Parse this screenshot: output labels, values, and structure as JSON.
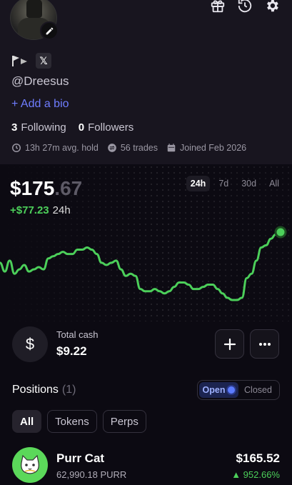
{
  "profile": {
    "handle": "@Dreesus",
    "add_bio": "+ Add a bio",
    "following_count": "3",
    "following_label": "Following",
    "followers_count": "0",
    "followers_label": "Followers",
    "avg_hold": "13h 27m avg. hold",
    "trades": "56 trades",
    "joined": "Joined Feb 2026",
    "social_x": "𝕏"
  },
  "portfolio": {
    "value_main": "$175",
    "value_cents": ".67",
    "change": "+$77.23",
    "change_period": "24h",
    "ranges": [
      "24h",
      "7d",
      "30d",
      "All"
    ],
    "active_range": "24h"
  },
  "chart_data": {
    "type": "line",
    "points": [
      72,
      64,
      74,
      62,
      66,
      70,
      64,
      66,
      68,
      66,
      76,
      78,
      80,
      82,
      80,
      80,
      84,
      84,
      86,
      84,
      80,
      72,
      70,
      72,
      74,
      66,
      60,
      62,
      60,
      48,
      46,
      46,
      48,
      46,
      44,
      46,
      50,
      54,
      54,
      52,
      48,
      48,
      50,
      52,
      52,
      48,
      44,
      40,
      38,
      38,
      40,
      58,
      62,
      74,
      86,
      88,
      94,
      98,
      100
    ],
    "line_color": "#4ccf5a"
  },
  "cash": {
    "icon": "$",
    "label": "Total cash",
    "value": "$9.22",
    "add": "+",
    "more": "•••"
  },
  "positions": {
    "title": "Positions",
    "count": "(1)",
    "toggle": [
      "Open",
      "Closed"
    ],
    "filters": [
      "All",
      "Tokens",
      "Perps"
    ],
    "items": [
      {
        "name": "Purr Cat",
        "amount": "62,990.18 PURR",
        "value": "$165.52",
        "change": "▲ 952.66%"
      }
    ]
  },
  "colors": {
    "accent": "#6f7dff",
    "up": "#4ccf5a",
    "bg": "#0c0a12",
    "card": "#18151f"
  }
}
